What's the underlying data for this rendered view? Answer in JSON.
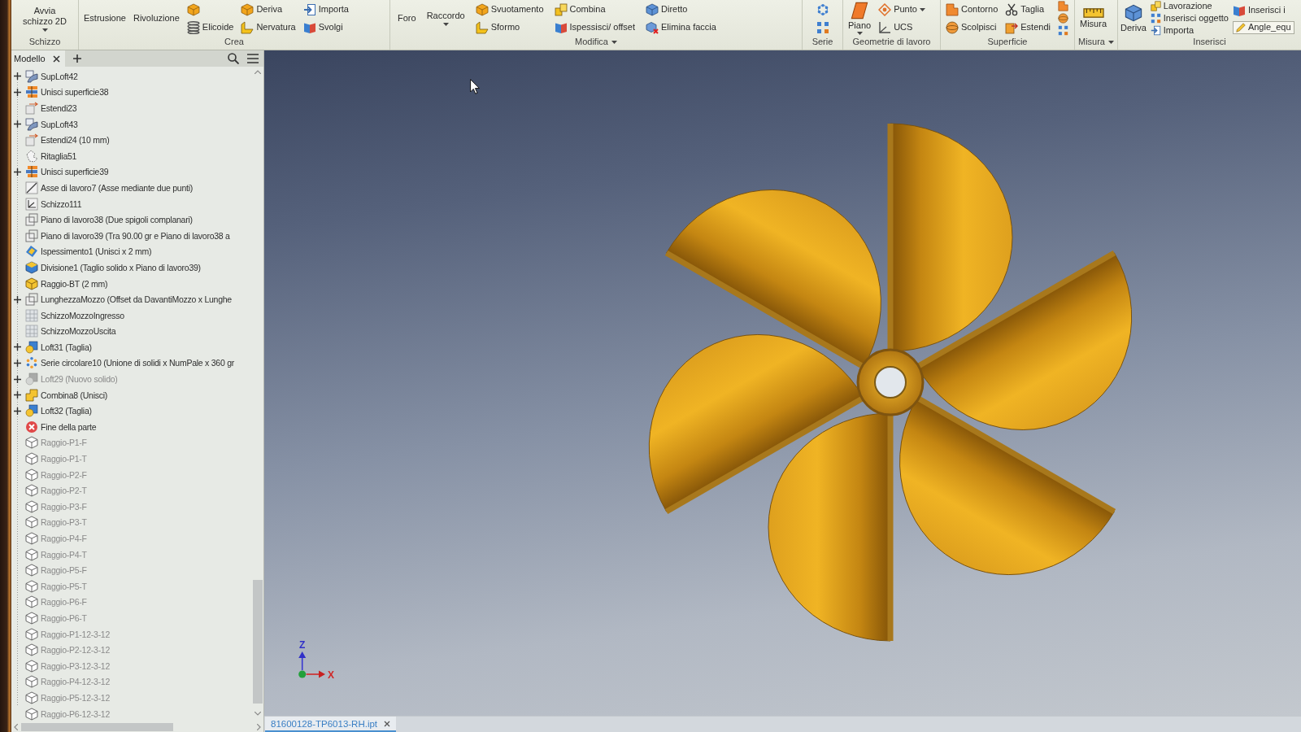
{
  "ribbon": {
    "groups": [
      {
        "label": "Schizzo",
        "columns": [
          [
            {
              "kind": "label",
              "label": "Avvia schizzo 2D",
              "dropdown": true
            }
          ]
        ]
      },
      {
        "label": "Crea",
        "columns": [
          [
            {
              "kind": "label",
              "label": "Estrusione"
            }
          ],
          [
            {
              "kind": "label",
              "label": "Rivoluzione"
            }
          ],
          [
            {
              "kind": "icon"
            },
            {
              "kind": "small",
              "label": "Elicoide"
            }
          ],
          [
            {
              "kind": "small",
              "label": "Deriva"
            },
            {
              "kind": "small",
              "label": "Nervatura"
            }
          ],
          [
            {
              "kind": "small",
              "label": "Importa"
            },
            {
              "kind": "small",
              "label": "Svolgi"
            }
          ]
        ]
      },
      {
        "label": "Modifica",
        "dropdown": true,
        "columns": [
          [
            {
              "kind": "label",
              "label": "Foro"
            }
          ],
          [
            {
              "kind": "label",
              "label": "Raccordo",
              "dropdown": true
            }
          ],
          [
            {
              "kind": "small",
              "label": "Svuotamento"
            },
            {
              "kind": "small",
              "label": "Sformo"
            }
          ],
          [
            {
              "kind": "small",
              "label": "Combina"
            },
            {
              "kind": "small",
              "label": "Ispessisci/ offset"
            }
          ],
          [
            {
              "kind": "small",
              "label": "Diretto"
            },
            {
              "kind": "small",
              "label": "Elimina faccia"
            }
          ]
        ]
      },
      {
        "label": "Serie",
        "columns": [
          [
            {
              "kind": "icon"
            },
            {
              "kind": "icon"
            }
          ]
        ]
      },
      {
        "label": "Geometrie di lavoro",
        "columns": [
          [
            {
              "kind": "large",
              "label": "Piano",
              "dropdown": true
            }
          ],
          [
            {
              "kind": "small",
              "label": "Punto",
              "dropdown": true
            },
            {
              "kind": "small",
              "label": "UCS"
            }
          ]
        ]
      },
      {
        "label": "Superficie",
        "columns": [
          [
            {
              "kind": "small",
              "label": "Contorno"
            },
            {
              "kind": "small",
              "label": "Scolpisci"
            }
          ],
          [
            {
              "kind": "small",
              "label": "Taglia"
            },
            {
              "kind": "small",
              "label": "Estendi"
            }
          ],
          [
            {
              "kind": "icon"
            },
            {
              "kind": "icon"
            },
            {
              "kind": "icon"
            }
          ]
        ]
      },
      {
        "label": "Misura",
        "dropdown": true,
        "columns": [
          [
            {
              "kind": "large",
              "label": "Misura"
            }
          ]
        ]
      },
      {
        "label": "Inserisci",
        "columns": [
          [
            {
              "kind": "large",
              "label": "Deriva"
            }
          ],
          [
            {
              "kind": "small",
              "label": "Lavorazione"
            },
            {
              "kind": "small",
              "label": "Inserisci oggetto"
            },
            {
              "kind": "small",
              "label": "Importa"
            }
          ],
          [
            {
              "kind": "small",
              "label": "Inserisci i"
            },
            {
              "kind": "combo",
              "label": "Angle_equ"
            }
          ]
        ]
      }
    ]
  },
  "browser": {
    "tab": "Modello",
    "items": [
      {
        "label": "SupLoft42",
        "kind": "surface",
        "expanded": false,
        "disabled": false
      },
      {
        "label": "Unisci superficie38",
        "kind": "stitch",
        "expanded": false,
        "disabled": false
      },
      {
        "label": "Estendi23",
        "kind": "extend",
        "disabled": false
      },
      {
        "label": "SupLoft43",
        "kind": "surface",
        "expanded": false,
        "disabled": false
      },
      {
        "label": "Estendi24 (10 mm)",
        "kind": "extend",
        "disabled": false
      },
      {
        "label": "Ritaglia51",
        "kind": "trim",
        "disabled": false
      },
      {
        "label": "Unisci superficie39",
        "kind": "stitch",
        "expanded": false,
        "disabled": false
      },
      {
        "label": "Asse di lavoro7 (Asse mediante due punti)",
        "kind": "axis",
        "disabled": false
      },
      {
        "label": "Schizzo111",
        "kind": "sketch",
        "disabled": false
      },
      {
        "label": "Piano di lavoro38 (Due spigoli complanari)",
        "kind": "plane",
        "disabled": false
      },
      {
        "label": "Piano di lavoro39 (Tra 90.00 gr e Piano di lavoro38 a",
        "kind": "plane",
        "disabled": false
      },
      {
        "label": "Ispessimento1 (Unisci x 2 mm)",
        "kind": "thicken",
        "disabled": false
      },
      {
        "label": "Divisione1 (Taglio solido x Piano di lavoro39)",
        "kind": "split",
        "disabled": false
      },
      {
        "label": "Raggio-BT (2 mm)",
        "kind": "fillet",
        "disabled": false
      },
      {
        "label": "LunghezzaMozzo (Offset da DavantiMozzo x Lunghe",
        "kind": "plane",
        "expanded": false,
        "disabled": false
      },
      {
        "label": "SchizzoMozzoIngresso",
        "kind": "sketch3d",
        "disabled": false
      },
      {
        "label": "SchizzoMozzoUscita",
        "kind": "sketch3d",
        "disabled": false
      },
      {
        "label": "Loft31 (Taglia)",
        "kind": "loft",
        "expanded": false,
        "disabled": false
      },
      {
        "label": "Serie circolare10 (Unione di solidi x NumPale x 360 gr",
        "kind": "pattern",
        "expanded": false,
        "disabled": false
      },
      {
        "label": "Loft29 (Nuovo solido)",
        "kind": "loft",
        "expanded": false,
        "disabled": true
      },
      {
        "label": "Combina8 (Unisci)",
        "kind": "combine",
        "expanded": false,
        "disabled": false
      },
      {
        "label": "Loft32 (Taglia)",
        "kind": "loft",
        "expanded": false,
        "disabled": false
      },
      {
        "label": "Fine della parte",
        "kind": "end",
        "disabled": false
      },
      {
        "label": "Raggio-P1-F",
        "kind": "fillet",
        "disabled": true
      },
      {
        "label": "Raggio-P1-T",
        "kind": "fillet",
        "disabled": true
      },
      {
        "label": "Raggio-P2-F",
        "kind": "fillet",
        "disabled": true
      },
      {
        "label": "Raggio-P2-T",
        "kind": "fillet",
        "disabled": true
      },
      {
        "label": "Raggio-P3-F",
        "kind": "fillet",
        "disabled": true
      },
      {
        "label": "Raggio-P3-T",
        "kind": "fillet",
        "disabled": true
      },
      {
        "label": "Raggio-P4-F",
        "kind": "fillet",
        "disabled": true
      },
      {
        "label": "Raggio-P4-T",
        "kind": "fillet",
        "disabled": true
      },
      {
        "label": "Raggio-P5-F",
        "kind": "fillet",
        "disabled": true
      },
      {
        "label": "Raggio-P5-T",
        "kind": "fillet",
        "disabled": true
      },
      {
        "label": "Raggio-P6-F",
        "kind": "fillet",
        "disabled": true
      },
      {
        "label": "Raggio-P6-T",
        "kind": "fillet",
        "disabled": true
      },
      {
        "label": "Raggio-P1-12-3-12",
        "kind": "fillet",
        "disabled": true
      },
      {
        "label": "Raggio-P2-12-3-12",
        "kind": "fillet",
        "disabled": true
      },
      {
        "label": "Raggio-P3-12-3-12",
        "kind": "fillet",
        "disabled": true
      },
      {
        "label": "Raggio-P4-12-3-12",
        "kind": "fillet",
        "disabled": true
      },
      {
        "label": "Raggio-P5-12-3-12",
        "kind": "fillet",
        "disabled": true
      },
      {
        "label": "Raggio-P6-12-3-12",
        "kind": "fillet",
        "disabled": true
      }
    ]
  },
  "viewport": {
    "triad": {
      "z_label": "Z",
      "x_label": "X"
    }
  },
  "documents": [
    {
      "label": "81600128-TP6013-RH.ipt",
      "selected": true
    }
  ]
}
